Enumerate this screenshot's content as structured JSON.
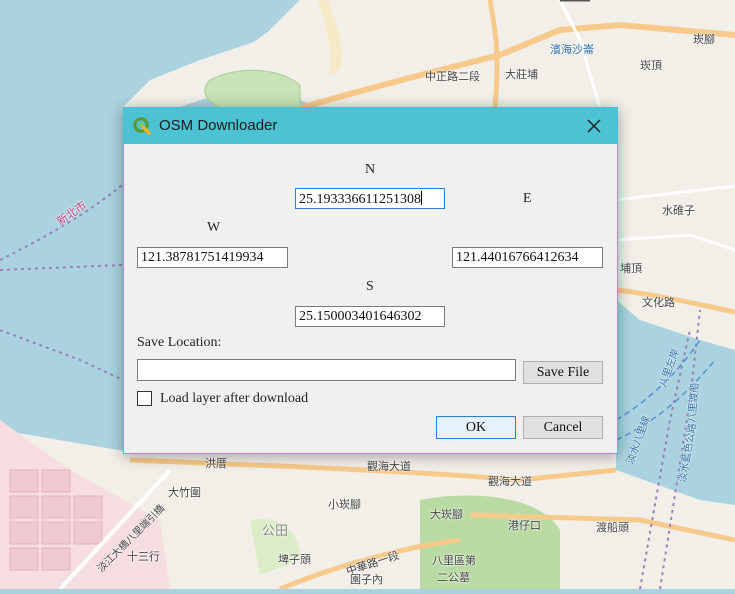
{
  "map": {
    "labels": {
      "binhai_beach": "濱海沙崙",
      "zhongzheng_rd2": "中正路二段",
      "dazhuangpu": "大莊埔",
      "kanding": "崁頂",
      "kanjiao": "崁腳",
      "new_taipei": "新北市",
      "shuiduizi": "水碓子",
      "puding": "埔頂",
      "wenhua_rd": "文化路",
      "honglin": "洪厝",
      "guanhai_ave": "觀海大道",
      "guanhai_ave2": "觀海大道",
      "dazhuwei": "大竹圍",
      "xiaokanjiao": "小崁腳",
      "dakanjiao": "大崁腳",
      "gangzaikou": "港仔口",
      "dukoutou": "渡船頭",
      "gongtian": "公田",
      "shisanhang": "十三行",
      "puzitou": "埤子頭",
      "zhonghua_rd1": "中華路一段",
      "bali_district": "八里區第",
      "ergongmu": "二公墓",
      "yuanzinei": "園子內",
      "tamsui_bridge": "淡江大橋八里端引橋",
      "bali_ferry": "淡水八里線",
      "bali_ferry2": "八里左岸",
      "tamsui_ferry": "淡水藍色公路",
      "bali_ferry3": "八里渡船"
    }
  },
  "dialog": {
    "title": "OSM Downloader",
    "north_label": "N",
    "north_value": "25.193336611251308",
    "east_label": "E",
    "east_value": "121.44016766412634",
    "west_label": "W",
    "west_value": "121.38781751419934",
    "south_label": "S",
    "south_value": "25.150003401646302",
    "save_location_label": "Save Location:",
    "save_location_value": "",
    "save_file_button": "Save File",
    "load_layer_label": "Load layer after download",
    "load_layer_checked": false,
    "ok_button": "OK",
    "cancel_button": "Cancel"
  },
  "colors": {
    "titlebar": "#4cc2d2",
    "water": "#aad3df",
    "land": "#f2efe9",
    "focus": "#2a7fd4"
  }
}
